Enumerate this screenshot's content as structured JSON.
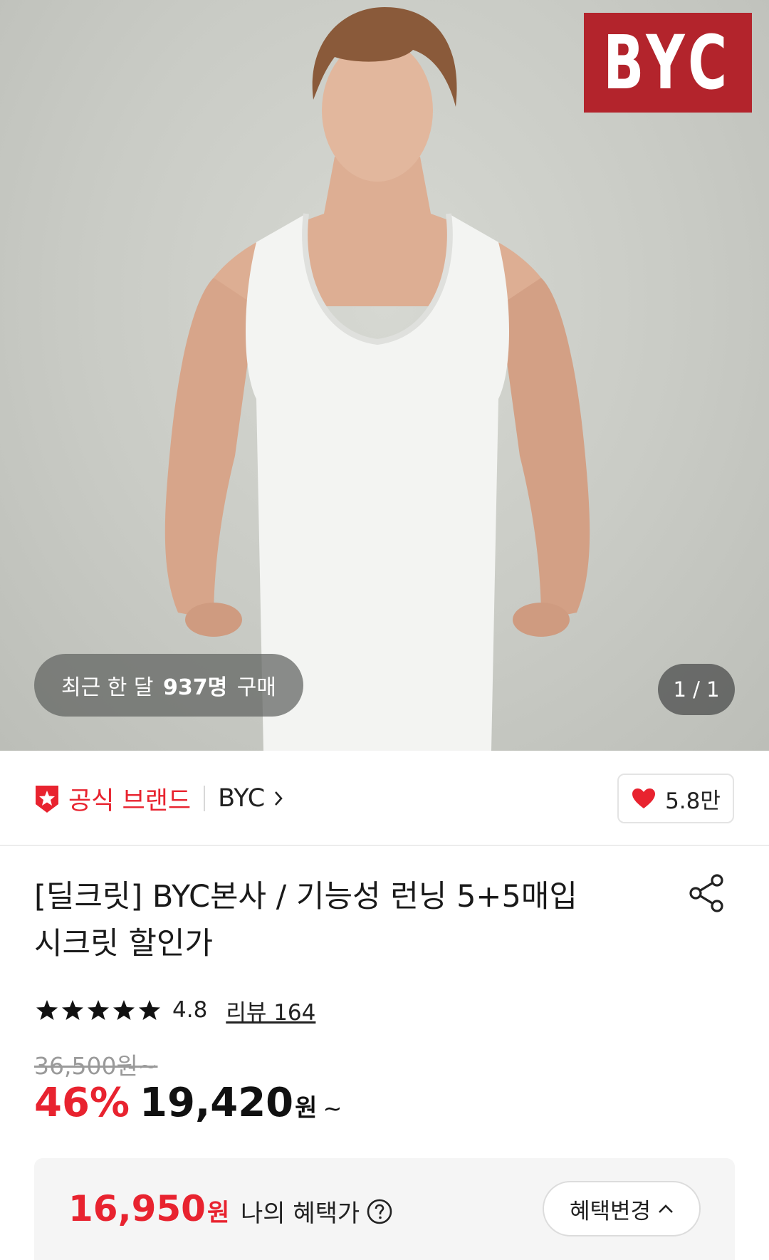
{
  "hero": {
    "brand_logo_text": "BYC",
    "purchase_prefix": "최근 한 달",
    "purchase_count": "937명",
    "purchase_suffix": "구매",
    "page_indicator": "1 / 1"
  },
  "brand_bar": {
    "official_label": "공식 브랜드",
    "brand_name": "BYC",
    "like_count": "5.8만"
  },
  "product": {
    "title_line1": "[딜크릿] BYC본사 / 기능성 런닝 5+5매입",
    "title_line2": "시크릿 할인가",
    "rating": "4.8",
    "review_label": "리뷰 164",
    "original_price": "36,500원~",
    "discount_rate": "46%",
    "sale_price": "19,420",
    "sale_unit": "원",
    "sale_tilde": "~"
  },
  "benefit": {
    "price": "16,950",
    "unit": "원",
    "label": "나의 혜택가",
    "button_label": "혜택변경"
  },
  "colors": {
    "accent_red": "#e8232f",
    "logo_red": "#b3242c"
  },
  "icons": [
    "official-brand-icon",
    "heart-icon",
    "share-icon",
    "star-icon",
    "help-icon",
    "chevron-right-icon",
    "chevron-up-icon"
  ]
}
